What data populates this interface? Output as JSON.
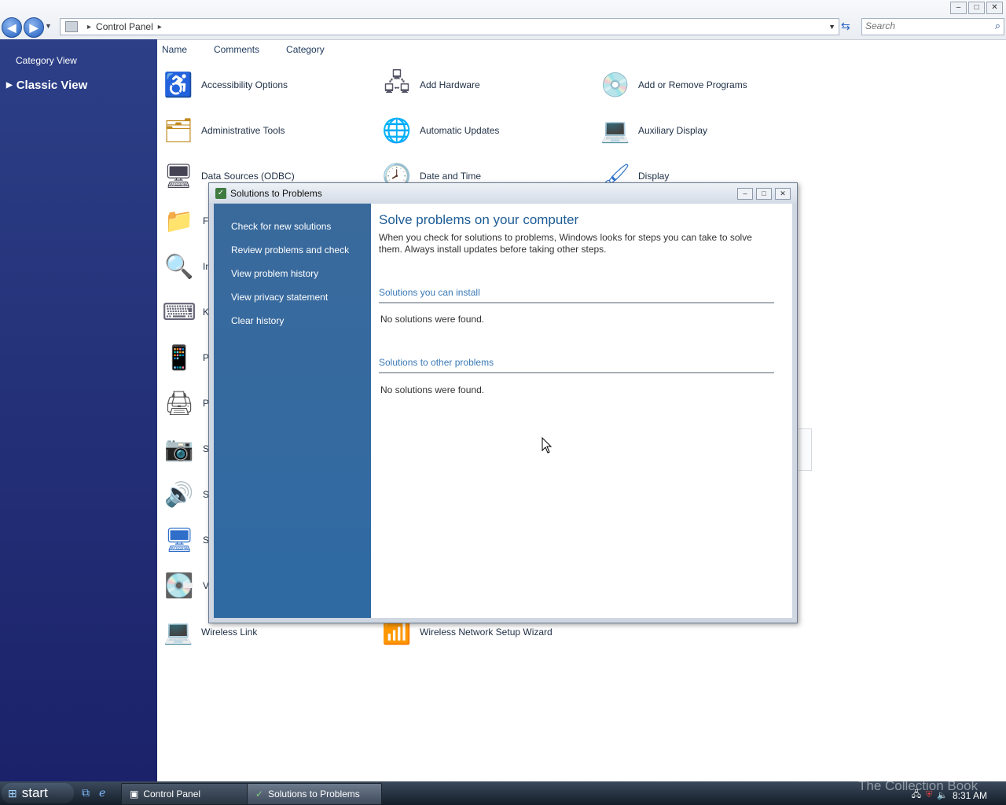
{
  "window": {
    "controls": [
      "–",
      "□",
      "✕"
    ]
  },
  "addressbar": {
    "path": [
      "Control Panel"
    ],
    "search_placeholder": "Search"
  },
  "leftpane": {
    "category_view": "Category View",
    "classic_view": "Classic View"
  },
  "columns": [
    "Name",
    "Comments",
    "Category"
  ],
  "items": [
    {
      "label": "Accessibility Options",
      "icon": "accessibility-icon"
    },
    {
      "label": "Add Hardware",
      "icon": "add-hardware-icon"
    },
    {
      "label": "Add or Remove Programs",
      "icon": "add-remove-programs-icon"
    },
    {
      "label": "Administrative Tools",
      "icon": "admin-tools-icon"
    },
    {
      "label": "Automatic Updates",
      "icon": "automatic-updates-icon"
    },
    {
      "label": "Auxiliary Display",
      "icon": "auxiliary-display-icon"
    },
    {
      "label": "Data Sources (ODBC)",
      "icon": "odbc-icon"
    },
    {
      "label": "Date and Time",
      "icon": "clock-icon"
    },
    {
      "label": "Display",
      "icon": "display-icon"
    },
    {
      "label": "Wireless Link",
      "icon": "wireless-link-icon"
    },
    {
      "label": "Wireless Network Setup Wizard",
      "icon": "wireless-setup-icon"
    }
  ],
  "partial_items": [
    "F",
    "In",
    "K",
    "P",
    "P",
    "S",
    "S",
    "S",
    "V"
  ],
  "dialog": {
    "title": "Solutions to Problems",
    "links": [
      "Check for new solutions",
      "Review problems and check",
      "View problem history",
      "View privacy statement",
      "Clear history"
    ],
    "heading": "Solve problems on your computer",
    "description": "When you check for solutions to problems, Windows looks for steps you can take to solve them. Always install updates before taking other steps.",
    "section1_title": "Solutions you can install",
    "section1_empty": "No solutions were found.",
    "section2_title": "Solutions to other problems",
    "section2_empty": "No solutions were found."
  },
  "taskbar": {
    "start_label": "start",
    "tasks": [
      "Control Panel",
      "Solutions to Problems"
    ],
    "watermark": "The Collection Book",
    "clock": "8:31 AM"
  }
}
